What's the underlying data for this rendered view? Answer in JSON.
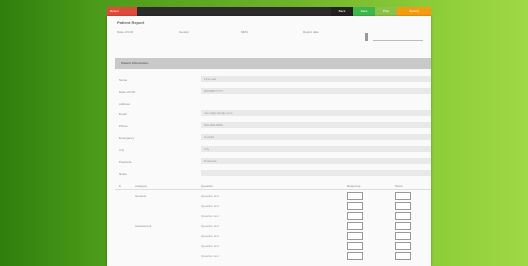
{
  "topbar": {
    "left_label": "Return",
    "buttons": [
      {
        "label": "Back",
        "color": "#222222"
      },
      {
        "label": "Save",
        "color": "#3fb84a"
      },
      {
        "label": "Print",
        "color": "#8bc34a"
      },
      {
        "label": "Submit",
        "color": "#f39c12"
      }
    ]
  },
  "header": {
    "title": "Patient Report",
    "fields": [
      "Date of birth",
      "Gender",
      "MRN",
      "Report date"
    ]
  },
  "section": {
    "title": "Patient Information"
  },
  "rows": [
    {
      "label": "Name",
      "value": "First Last"
    },
    {
      "label": "Date of birth",
      "value": "DD/MM/YYYY"
    },
    {
      "label": "Address",
      "value": ""
    },
    {
      "label": "Email",
      "value": "name@example.com"
    },
    {
      "label": "Phone",
      "value": "000-000-0000"
    },
    {
      "label": "Emergency",
      "value": "Contact"
    },
    {
      "label": "City",
      "value": "City"
    },
    {
      "label": "Postcode",
      "value": "Postcode"
    },
    {
      "label": "Notes",
      "value": ""
    }
  ],
  "table": {
    "headers": [
      "#",
      "Category",
      "Question",
      "Response",
      "Score"
    ],
    "rows": [
      {
        "group": "General",
        "question": "Question text"
      },
      {
        "group": "",
        "question": "Question text"
      },
      {
        "group": "",
        "question": "Question text"
      },
      {
        "group": "Assessment",
        "question": "Question text"
      },
      {
        "group": "",
        "question": "Question text"
      },
      {
        "group": "",
        "question": "Question text"
      },
      {
        "group": "",
        "question": "Question text"
      }
    ]
  }
}
